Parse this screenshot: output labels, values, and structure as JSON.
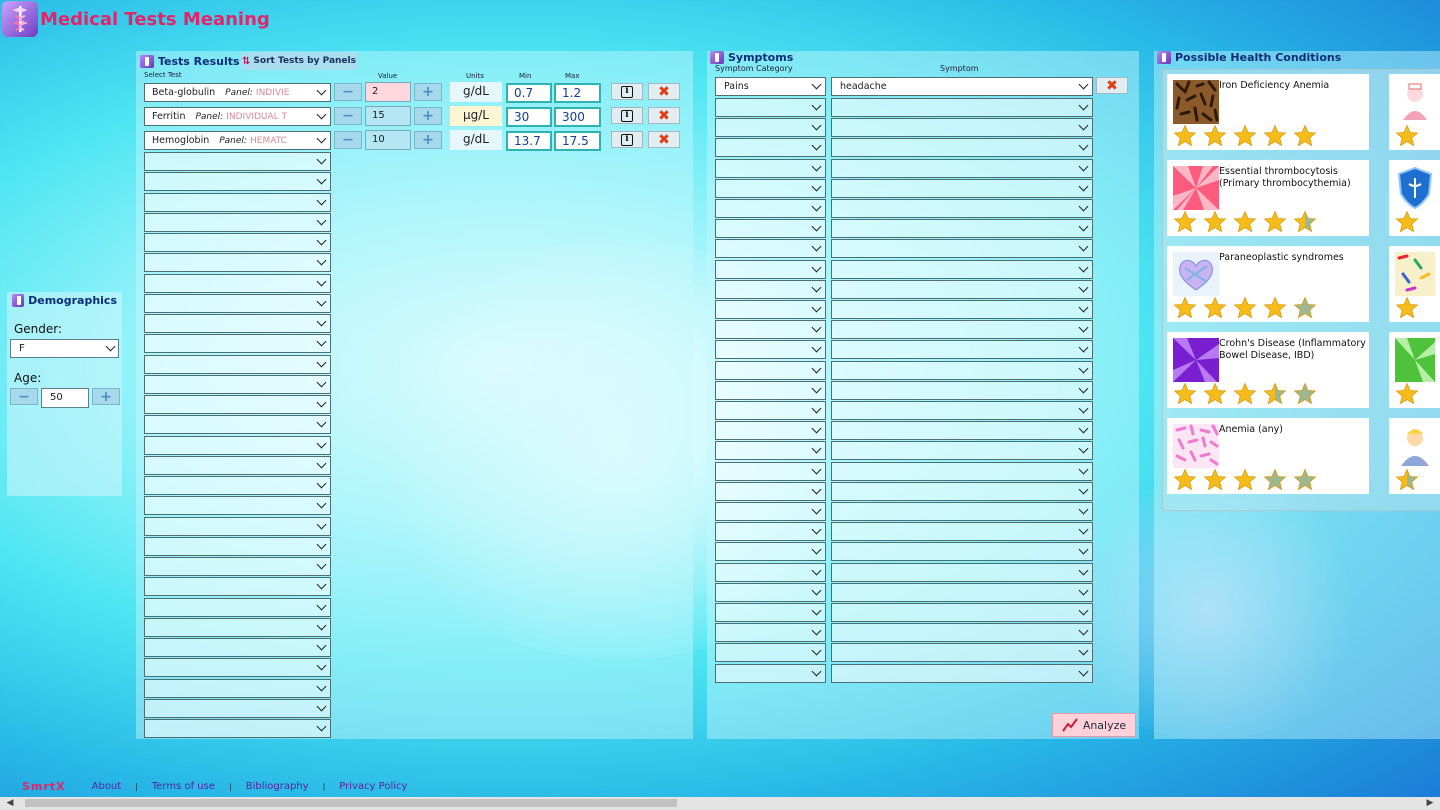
{
  "app": {
    "title": "Medical Tests Meaning"
  },
  "demographics": {
    "title": "Demographics",
    "gender_label": "Gender:",
    "gender_value": "F",
    "age_label": "Age:",
    "age_value": "50"
  },
  "tests": {
    "title": "Tests Results",
    "sort_button": "Sort Tests by Panels",
    "col_select": "Select Test",
    "col_value": "Value",
    "col_units": "Units",
    "col_min": "Min",
    "col_max": "Max",
    "panel_prefix": "Panel:",
    "rows": [
      {
        "name": "Beta-globulin",
        "panel": "INDIVIE",
        "value": "2",
        "units": "g/dL",
        "min": "0.7",
        "max": "1.2"
      },
      {
        "name": "Ferritin",
        "panel": "INDIVIDUAL T",
        "value": "15",
        "units": "μg/L",
        "min": "30",
        "max": "300"
      },
      {
        "name": "Hemoglobin",
        "panel": "HEMATC",
        "value": "10",
        "units": "g/dL",
        "min": "13.7",
        "max": "17.5"
      }
    ]
  },
  "symptoms": {
    "title": "Symptoms",
    "col_category": "Symptom Category",
    "col_symptom": "Symptom",
    "rows": [
      {
        "category": "Pains",
        "symptom": "headache"
      }
    ],
    "analyze_button": "Analyze"
  },
  "conditions": {
    "title": "Possible Health Conditions",
    "items": [
      {
        "name": "Iron Deficiency Anemia",
        "rating": 5
      },
      {
        "name": "Essential thrombocytosis (Primary thrombocythemia)",
        "rating": 4.5
      },
      {
        "name": "Paraneoplastic syndromes",
        "rating": 4
      },
      {
        "name": "Crohn's Disease (Inflammatory Bowel Disease, IBD)",
        "rating": 3.5
      },
      {
        "name": "Anemia (any)",
        "rating": 3
      }
    ]
  },
  "footer": {
    "brand": "SmrtX",
    "links": [
      "About",
      "Terms of use",
      "Bibliography",
      "Privacy Policy"
    ]
  },
  "colors": {
    "title": "#e4246a",
    "star": "#f6bd1a",
    "star_empty": "#9db88e",
    "remove": "#e23c14"
  }
}
